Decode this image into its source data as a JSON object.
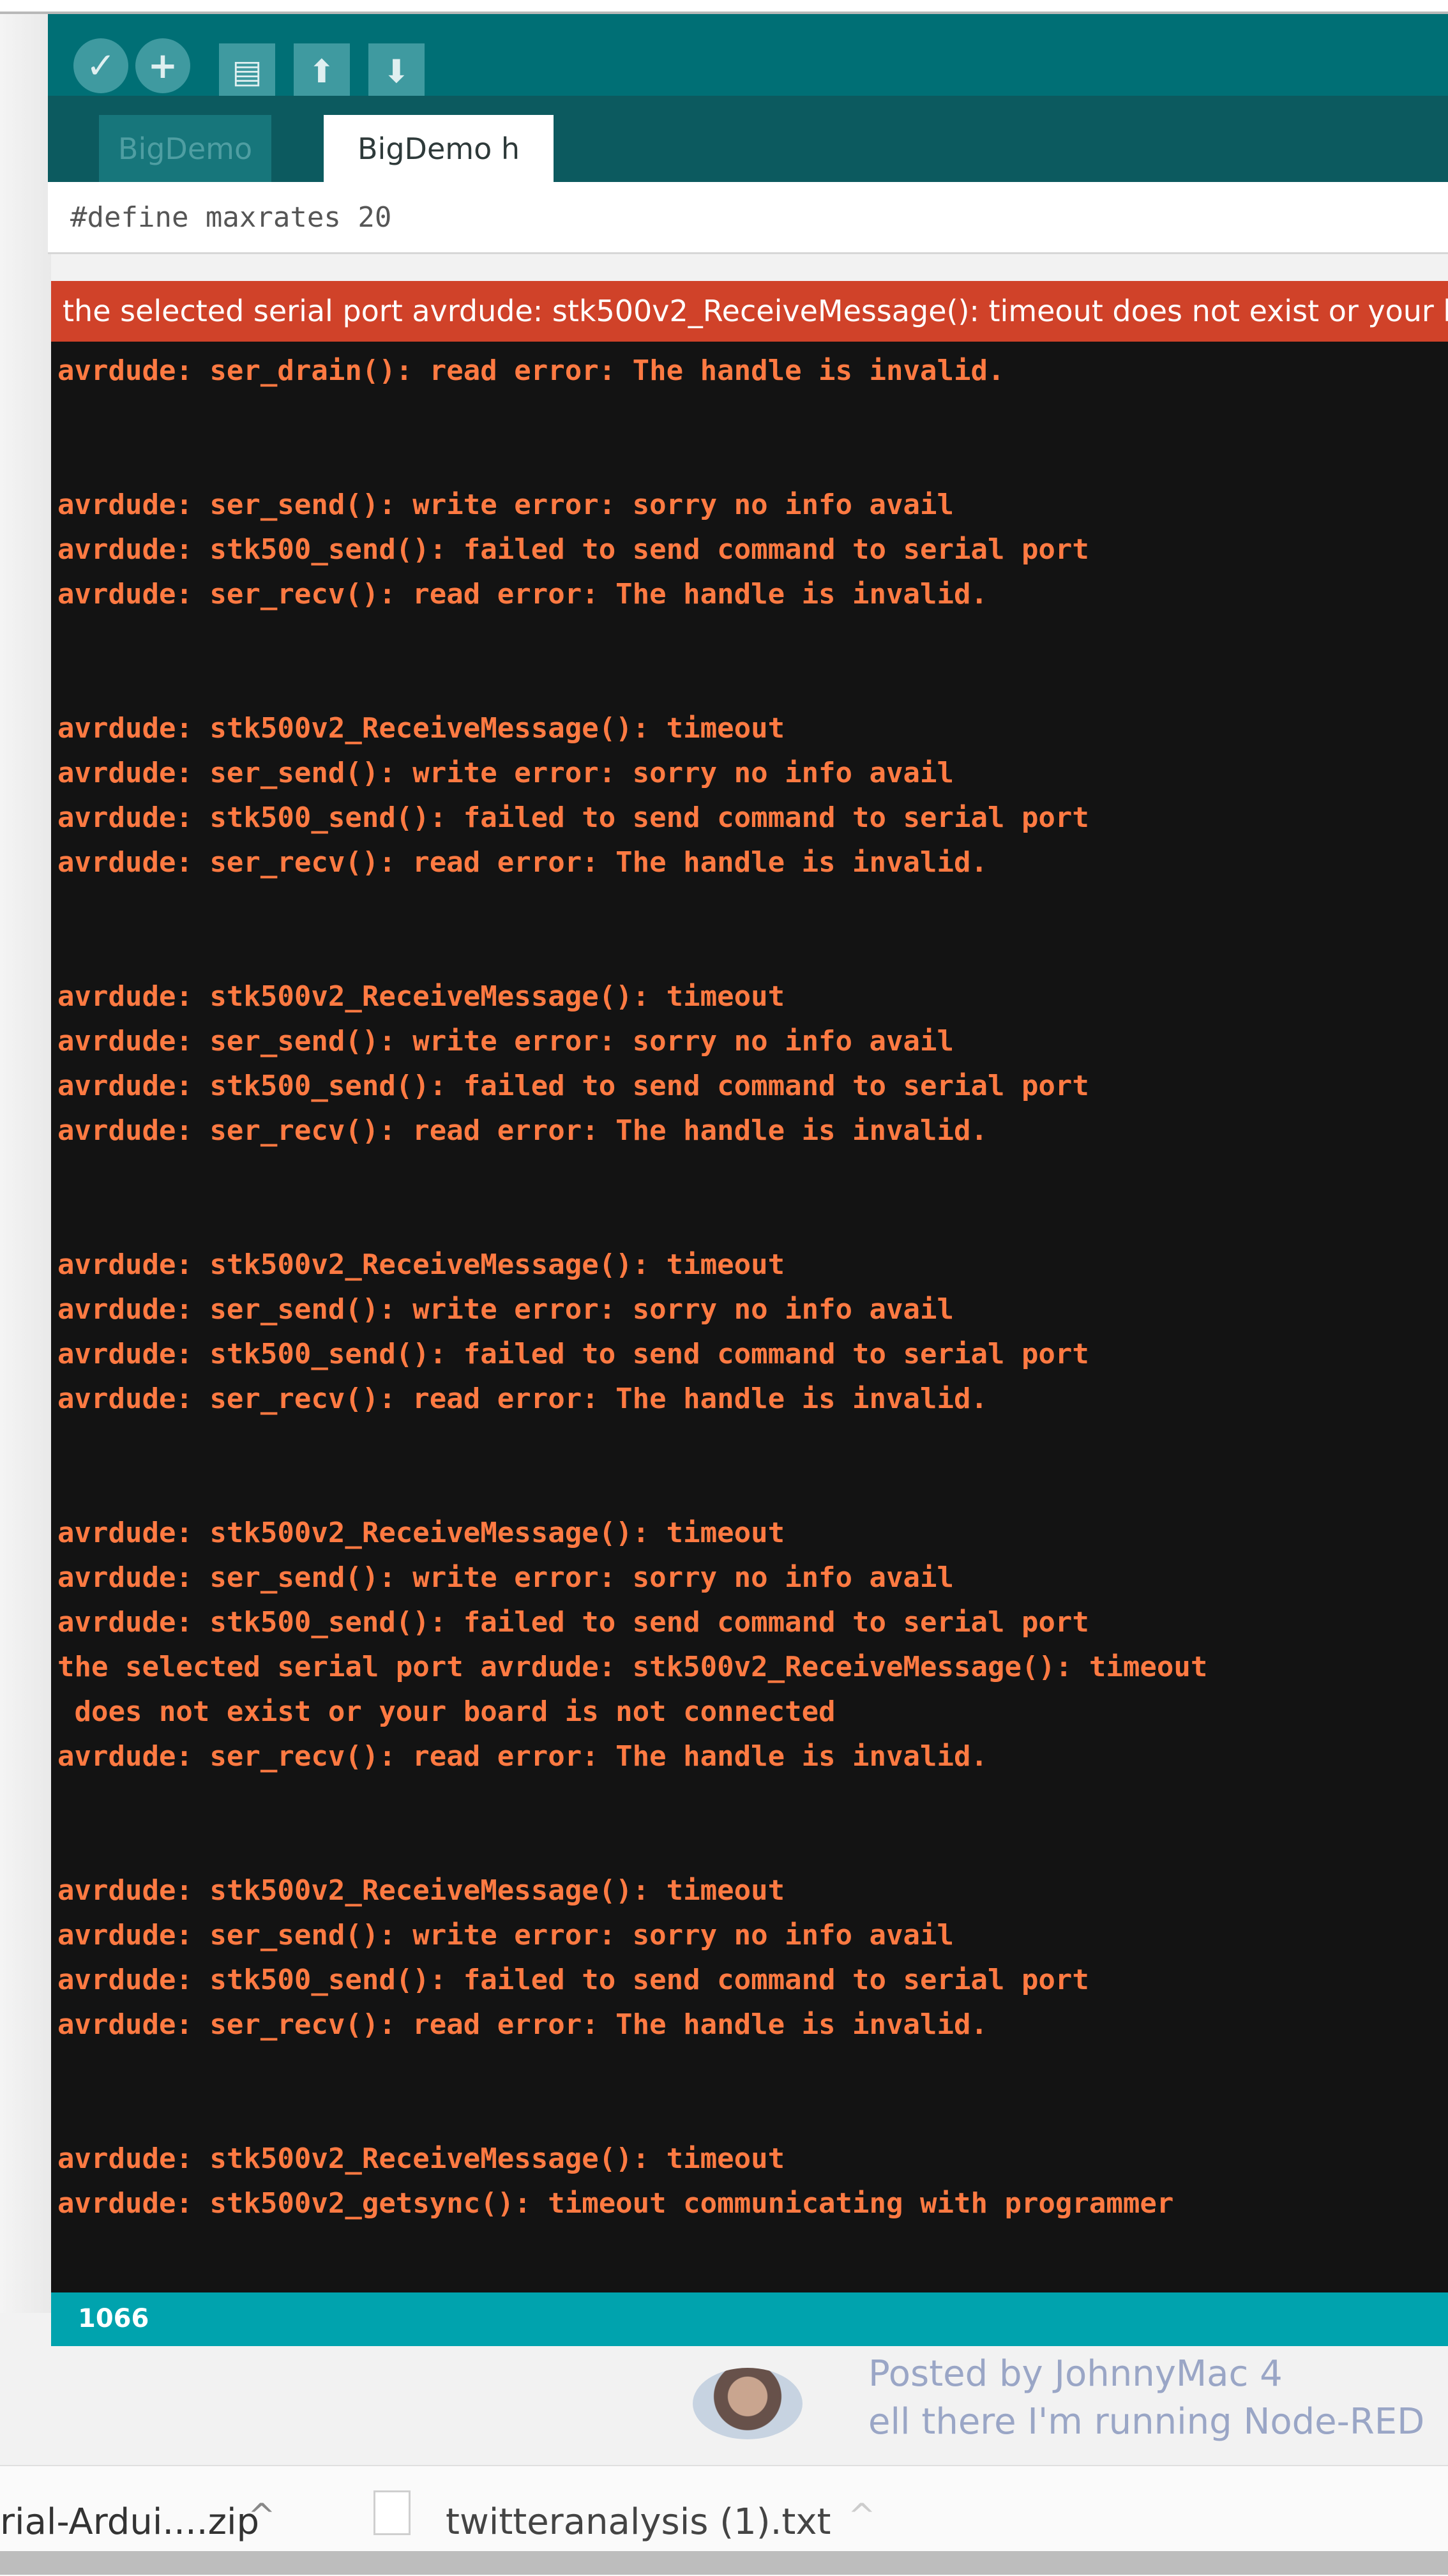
{
  "toolbar": {
    "verify_icon": "check-icon",
    "upload_icon": "plus-icon",
    "new_icon": "document-icon",
    "open_icon": "arrow-up-icon",
    "save_icon": "arrow-down-icon"
  },
  "tabs": [
    {
      "label": "BigDemo",
      "active": false
    },
    {
      "label": "BigDemo h",
      "active": true
    }
  ],
  "editor": {
    "code_line": "#define maxrates 20"
  },
  "error_banner": {
    "text": "the selected serial port avrdude: stk500v2_ReceiveMessage(): timeout does not exist or your b"
  },
  "console": {
    "lines": [
      "avrdude: ser_drain(): read error: The handle is invalid.",
      "",
      "",
      "avrdude: ser_send(): write error: sorry no info avail",
      "avrdude: stk500_send(): failed to send command to serial port",
      "avrdude: ser_recv(): read error: The handle is invalid.",
      "",
      "",
      "avrdude: stk500v2_ReceiveMessage(): timeout",
      "avrdude: ser_send(): write error: sorry no info avail",
      "avrdude: stk500_send(): failed to send command to serial port",
      "avrdude: ser_recv(): read error: The handle is invalid.",
      "",
      "",
      "avrdude: stk500v2_ReceiveMessage(): timeout",
      "avrdude: ser_send(): write error: sorry no info avail",
      "avrdude: stk500_send(): failed to send command to serial port",
      "avrdude: ser_recv(): read error: The handle is invalid.",
      "",
      "",
      "avrdude: stk500v2_ReceiveMessage(): timeout",
      "avrdude: ser_send(): write error: sorry no info avail",
      "avrdude: stk500_send(): failed to send command to serial port",
      "avrdude: ser_recv(): read error: The handle is invalid.",
      "",
      "",
      "avrdude: stk500v2_ReceiveMessage(): timeout",
      "avrdude: ser_send(): write error: sorry no info avail",
      "avrdude: stk500_send(): failed to send command to serial port",
      "the selected serial port avrdude: stk500v2_ReceiveMessage(): timeout",
      " does not exist or your board is not connected",
      "avrdude: ser_recv(): read error: The handle is invalid.",
      "",
      "",
      "avrdude: stk500v2_ReceiveMessage(): timeout",
      "avrdude: ser_send(): write error: sorry no info avail",
      "avrdude: stk500_send(): failed to send command to serial port",
      "avrdude: ser_recv(): read error: The handle is invalid.",
      "",
      "",
      "avrdude: stk500v2_ReceiveMessage(): timeout",
      "avrdude: stk500v2_getsync(): timeout communicating with programmer"
    ]
  },
  "status_bar": {
    "line_number": "1066"
  },
  "background_page": {
    "line1": "Posted by JohnnyMac 4",
    "line2": "ell there I'm running Node-RED"
  },
  "downloads": {
    "item1": "rial-Ardui....zip",
    "item2": "twitteranalysis (1).txt"
  },
  "colors": {
    "toolbar": "#006f75",
    "error_banner": "#d04229",
    "console_text": "#ff7a42",
    "status_bar": "#00a3ae"
  }
}
